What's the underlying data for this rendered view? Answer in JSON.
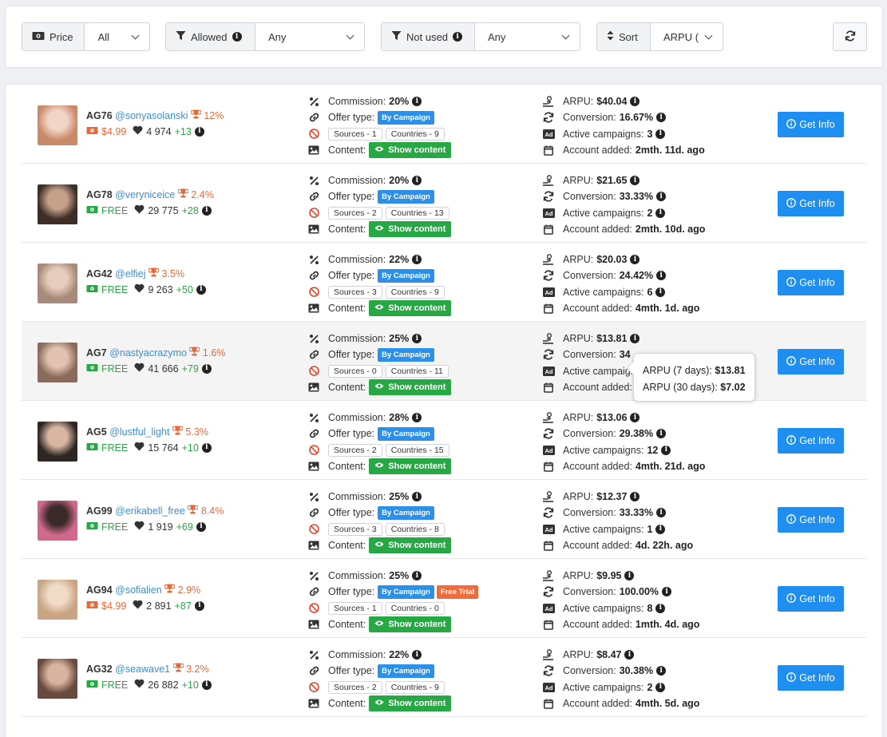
{
  "filters": {
    "price": {
      "label": "Price",
      "value": "All"
    },
    "allowed": {
      "label": "Allowed",
      "value": "Any"
    },
    "not_used": {
      "label": "Not used",
      "value": "Any"
    },
    "sort": {
      "label": "Sort",
      "value": "ARPU ("
    }
  },
  "labels": {
    "commission": "Commission:",
    "offer_type": "Offer type:",
    "content": "Content:",
    "arpu": "ARPU:",
    "conversion": "Conversion:",
    "active_campaigns": "Active campaigns:",
    "account_added": "Account added:",
    "show_content": "Show content",
    "get_info": "Get Info",
    "by_campaign": "By Campaign",
    "free_trial": "Free Trial"
  },
  "tooltip": {
    "line1_label": "ARPU (7 days):",
    "line1_value": "$13.81",
    "line2_label": "ARPU (30 days):",
    "line2_value": "$7.02"
  },
  "rows": [
    {
      "code": "AG76",
      "handle": "@sonyasolanski",
      "rank_pct": "12%",
      "price": "$4.99",
      "price_type": "paid",
      "likes": "4 974",
      "likes_delta": "+13",
      "commission": "20%",
      "free_trial": false,
      "sources": "Sources - 1",
      "countries": "Countries - 9",
      "arpu": "$40.04",
      "conversion": "16.67%",
      "active_campaigns": "3",
      "account_added": "2mth. 11d. ago",
      "avatar_colors": [
        "#c98a6a",
        "#f1d5c6"
      ]
    },
    {
      "code": "AG78",
      "handle": "@veryniceice",
      "rank_pct": "2.4%",
      "price": "FREE",
      "price_type": "free",
      "likes": "29 775",
      "likes_delta": "+28",
      "commission": "20%",
      "free_trial": false,
      "sources": "Sources - 2",
      "countries": "Countries - 13",
      "arpu": "$21.65",
      "conversion": "33.33%",
      "active_campaigns": "2",
      "account_added": "2mth. 10d. ago",
      "avatar_colors": [
        "#3d2f27",
        "#c7a08a"
      ]
    },
    {
      "code": "AG42",
      "handle": "@elfiej",
      "rank_pct": "3.5%",
      "price": "FREE",
      "price_type": "free",
      "likes": "9 263",
      "likes_delta": "+50",
      "commission": "22%",
      "free_trial": false,
      "sources": "Sources - 3",
      "countries": "Countries - 9",
      "arpu": "$20.03",
      "conversion": "24.42%",
      "active_campaigns": "6",
      "account_added": "4mth. 1d. ago",
      "avatar_colors": [
        "#a88a7a",
        "#e7cdbd"
      ]
    },
    {
      "code": "AG7",
      "handle": "@nastyacrazymo",
      "rank_pct": "1.6%",
      "price": "FREE",
      "price_type": "free",
      "likes": "41 666",
      "likes_delta": "+79",
      "commission": "25%",
      "free_trial": false,
      "sources": "Sources - 0",
      "countries": "Countries - 11",
      "arpu": "$13.81",
      "conversion": "34",
      "active_campaigns": "",
      "account_added": "",
      "avatar_colors": [
        "#8a6a5a",
        "#e2c2b0"
      ]
    },
    {
      "code": "AG5",
      "handle": "@lustful_light",
      "rank_pct": "5.3%",
      "price": "FREE",
      "price_type": "free",
      "likes": "15 764",
      "likes_delta": "+10",
      "commission": "28%",
      "free_trial": false,
      "sources": "Sources - 2",
      "countries": "Countries - 15",
      "arpu": "$13.06",
      "conversion": "29.38%",
      "active_campaigns": "12",
      "account_added": "4mth. 21d. ago",
      "avatar_colors": [
        "#2e2622",
        "#d8b6a2"
      ]
    },
    {
      "code": "AG99",
      "handle": "@erikabell_free",
      "rank_pct": "8.4%",
      "price": "FREE",
      "price_type": "free",
      "likes": "1 919",
      "likes_delta": "+69",
      "commission": "25%",
      "free_trial": false,
      "sources": "Sources - 3",
      "countries": "Countries - 8",
      "arpu": "$12.37",
      "conversion": "33.33%",
      "active_campaigns": "1",
      "account_added": "4d. 22h. ago",
      "avatar_colors": [
        "#d06a8c",
        "#3a2a2a"
      ]
    },
    {
      "code": "AG94",
      "handle": "@sofialien",
      "rank_pct": "2.9%",
      "price": "$4.99",
      "price_type": "paid",
      "likes": "2 891",
      "likes_delta": "+87",
      "commission": "25%",
      "free_trial": true,
      "sources": "Sources - 1",
      "countries": "Countries - 0",
      "arpu": "$9.95",
      "conversion": "100.00%",
      "active_campaigns": "8",
      "account_added": "1mth. 4d. ago",
      "avatar_colors": [
        "#c9a583",
        "#f0dac8"
      ]
    },
    {
      "code": "AG32",
      "handle": "@seawave1",
      "rank_pct": "3.2%",
      "price": "FREE",
      "price_type": "free",
      "likes": "26 882",
      "likes_delta": "+10",
      "commission": "22%",
      "free_trial": false,
      "sources": "Sources - 2",
      "countries": "Countries - 9",
      "arpu": "$8.47",
      "conversion": "30.38%",
      "active_campaigns": "2",
      "account_added": "4mth. 5d. ago",
      "avatar_colors": [
        "#6a4a3e",
        "#d9b3a0"
      ]
    }
  ]
}
